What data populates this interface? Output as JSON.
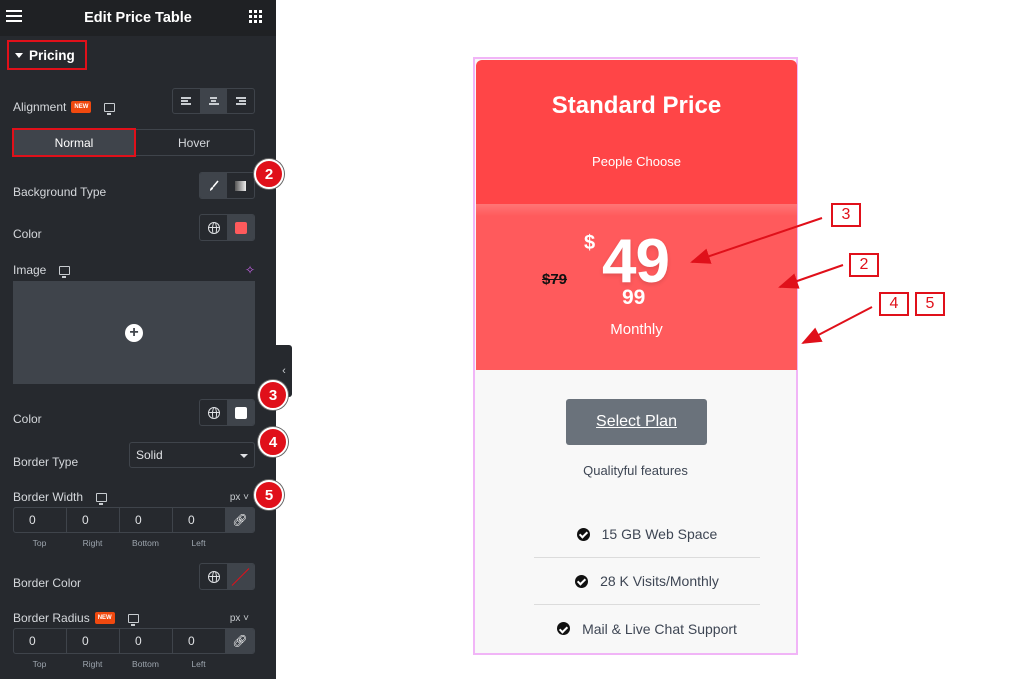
{
  "panel": {
    "title": "Edit Price Table",
    "section": "Pricing",
    "alignment": {
      "label": "Alignment",
      "badge": "NEW",
      "options": [
        "left",
        "center",
        "right"
      ],
      "selected": "center"
    },
    "tabs": [
      {
        "label": "Normal",
        "active": true
      },
      {
        "label": "Hover",
        "active": false
      }
    ],
    "background_type": {
      "label": "Background Type",
      "options": [
        "classic",
        "gradient"
      ],
      "selected": "classic"
    },
    "color": {
      "label": "Color",
      "value": "#ff5a5c"
    },
    "image": {
      "label": "Image"
    },
    "color2": {
      "label": "Color",
      "value": "#ffffff"
    },
    "border_type": {
      "label": "Border Type",
      "value": "Solid"
    },
    "border_width": {
      "label": "Border Width",
      "unit": "px",
      "values": [
        "0",
        "0",
        "0",
        "0"
      ],
      "labels": [
        "Top",
        "Right",
        "Bottom",
        "Left"
      ]
    },
    "border_color": {
      "label": "Border Color"
    },
    "border_radius": {
      "label": "Border Radius",
      "badge": "NEW",
      "unit": "px",
      "values": [
        "0",
        "0",
        "0",
        "0"
      ],
      "labels": [
        "Top",
        "Right",
        "Bottom",
        "Left"
      ]
    },
    "step_badges": [
      "2",
      "3",
      "4",
      "5"
    ]
  },
  "card": {
    "title": "Standard Price",
    "subtitle": "People Choose",
    "old_price": "$79",
    "currency": "$",
    "price": "49",
    "cents": "99",
    "period": "Monthly",
    "button": "Select Plan",
    "features_title": "Qualityful features",
    "features": [
      "15 GB Web Space",
      "28 K Visits/Monthly",
      "Mail & Live Chat Support"
    ]
  },
  "callouts": [
    "3",
    "2",
    "4",
    "5"
  ],
  "colors": {
    "accent": "#ff4547",
    "price_bg": "#ff5a5c",
    "annotation": "#e0101a",
    "panel_bg": "#26292e"
  }
}
